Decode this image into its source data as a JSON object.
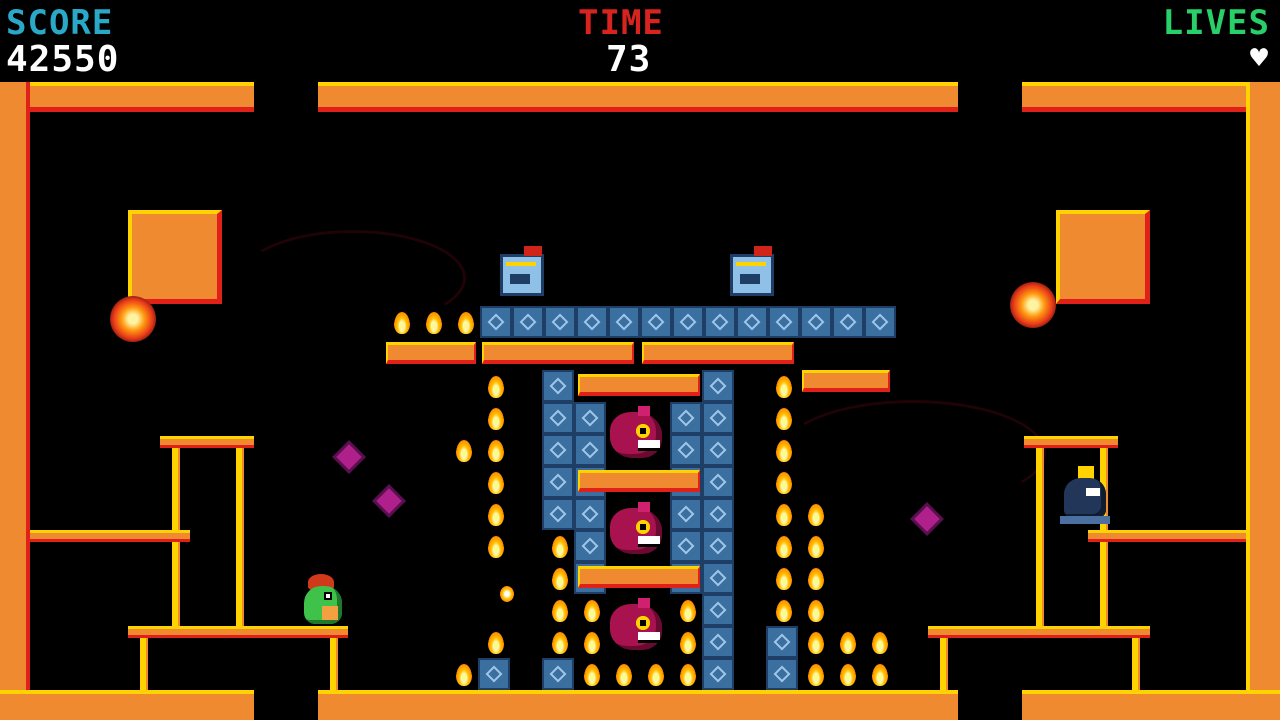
{
  "hud": {
    "score_label": "SCORE",
    "score_value": "42550",
    "time_label": "TIME",
    "time_value": "73",
    "lives_label": "LIVES",
    "lives_count": 1,
    "colors": {
      "score": "#2aa8c8",
      "time": "#d8231f",
      "lives": "#28d06a"
    }
  },
  "scene": {
    "wall_color": "#f08a30",
    "highlight_color": "#ffd300",
    "shadow_color": "#e0211a",
    "tile_color": "#3b6fa0",
    "characters": {
      "player": "green-dragon",
      "enemies": [
        "blue-robot",
        "blue-robot",
        "magenta-bird",
        "magenta-bird",
        "magenta-bird",
        "dark-ghost"
      ]
    },
    "hazards": [
      "fireball",
      "fireball",
      "purple-spark",
      "purple-spark",
      "purple-spark"
    ]
  }
}
